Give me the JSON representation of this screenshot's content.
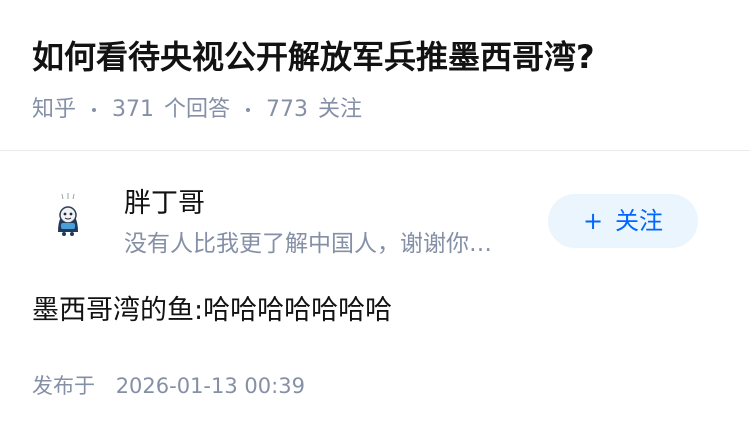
{
  "question": {
    "title": "如何看待央视公开解放军兵推墨西哥湾?",
    "source": "知乎",
    "answer_count": "371",
    "answer_label": "个回答",
    "follower_count": "773",
    "follower_label": "关注"
  },
  "author": {
    "name": "胖丁哥",
    "headline": "没有人比我更了解中国人，谢谢你…",
    "follow_label": "关注",
    "follow_prefix": "+"
  },
  "answer": {
    "content": "墨西哥湾的鱼:哈哈哈哈哈哈哈",
    "published_label": "发布于",
    "published_time": "2026-01-13 00:39"
  },
  "colors": {
    "accent": "#0066ff",
    "follow_bg": "#ebf5fd",
    "meta_text": "#8590a6",
    "primary_text": "#121212"
  },
  "icons": {
    "avatar": "cartoon-avatar-icon"
  }
}
